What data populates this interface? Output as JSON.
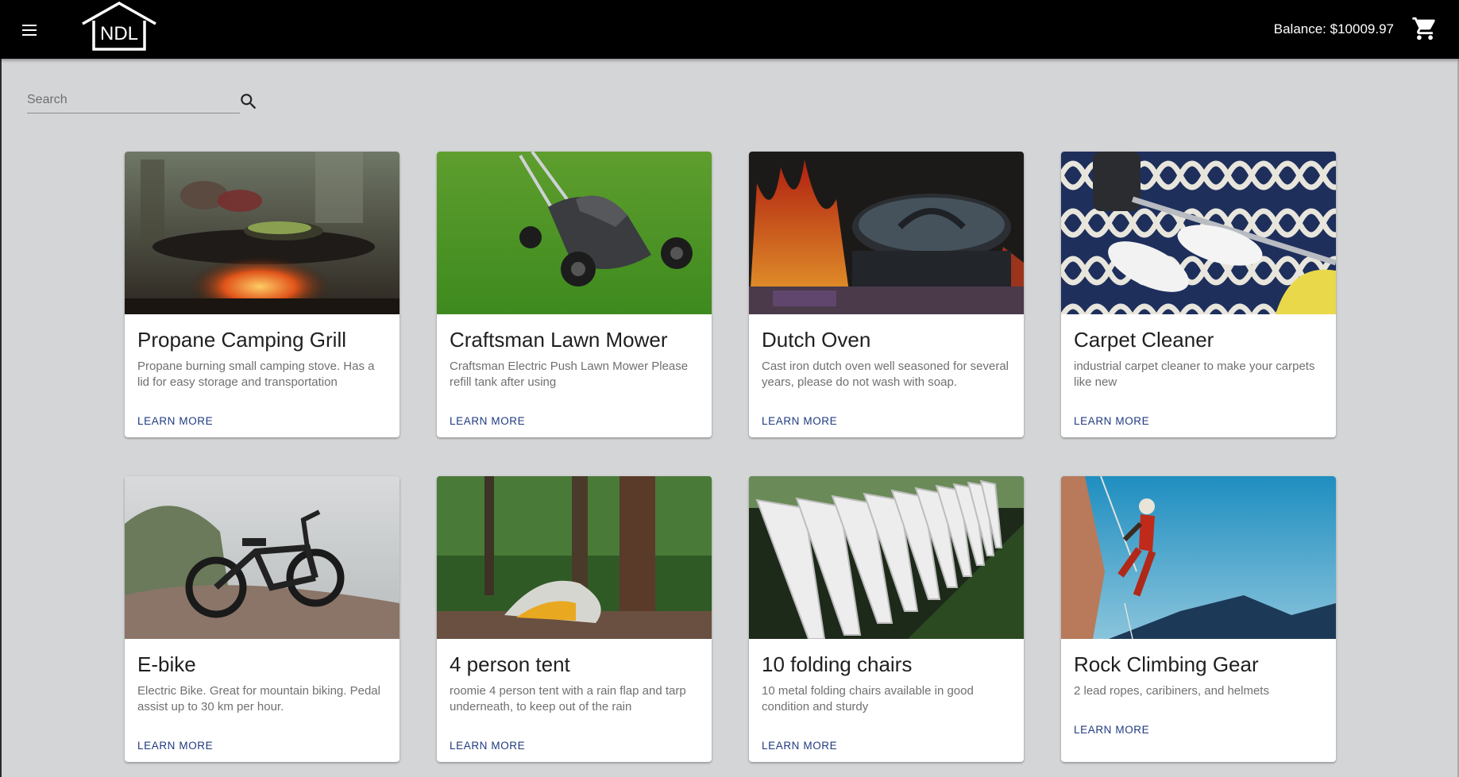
{
  "header": {
    "logo_text": "NDL",
    "balance": "Balance: $10009.97"
  },
  "search": {
    "placeholder": "Search",
    "value": ""
  },
  "products": [
    {
      "title": "Propane Camping Grill",
      "description": "Propane burning small camping stove. Has a lid for easy storage and transportation",
      "action": "LEARN MORE"
    },
    {
      "title": "Craftsman Lawn Mower",
      "description": "Craftsman Electric Push Lawn Mower Please refill tank after using",
      "action": "LEARN MORE"
    },
    {
      "title": "Dutch Oven",
      "description": "Cast iron dutch oven well seasoned for several years, please do not wash with soap.",
      "action": "LEARN MORE"
    },
    {
      "title": "Carpet Cleaner",
      "description": "industrial carpet cleaner to make your carpets like new",
      "action": "LEARN MORE"
    },
    {
      "title": "E-bike",
      "description": "Electric Bike. Great for mountain biking. Pedal assist up to 30 km per hour.",
      "action": "LEARN MORE"
    },
    {
      "title": "4 person tent",
      "description": "roomie 4 person tent with a rain flap and tarp underneath, to keep out of the rain",
      "action": "LEARN MORE"
    },
    {
      "title": "10 folding chairs",
      "description": "10 metal folding chairs available in good condition and sturdy",
      "action": "LEARN MORE"
    },
    {
      "title": "Rock Climbing Gear",
      "description": "2 lead ropes, caribiners, and helmets",
      "action": "LEARN MORE"
    }
  ],
  "icons": {
    "menu": "menu-icon",
    "logo": "house-logo",
    "cart": "shopping-cart-icon",
    "search": "search-icon"
  },
  "colors": {
    "appbar": "#000000",
    "background": "#d4d5d7",
    "card": "#ffffff",
    "action": "#203a80"
  }
}
